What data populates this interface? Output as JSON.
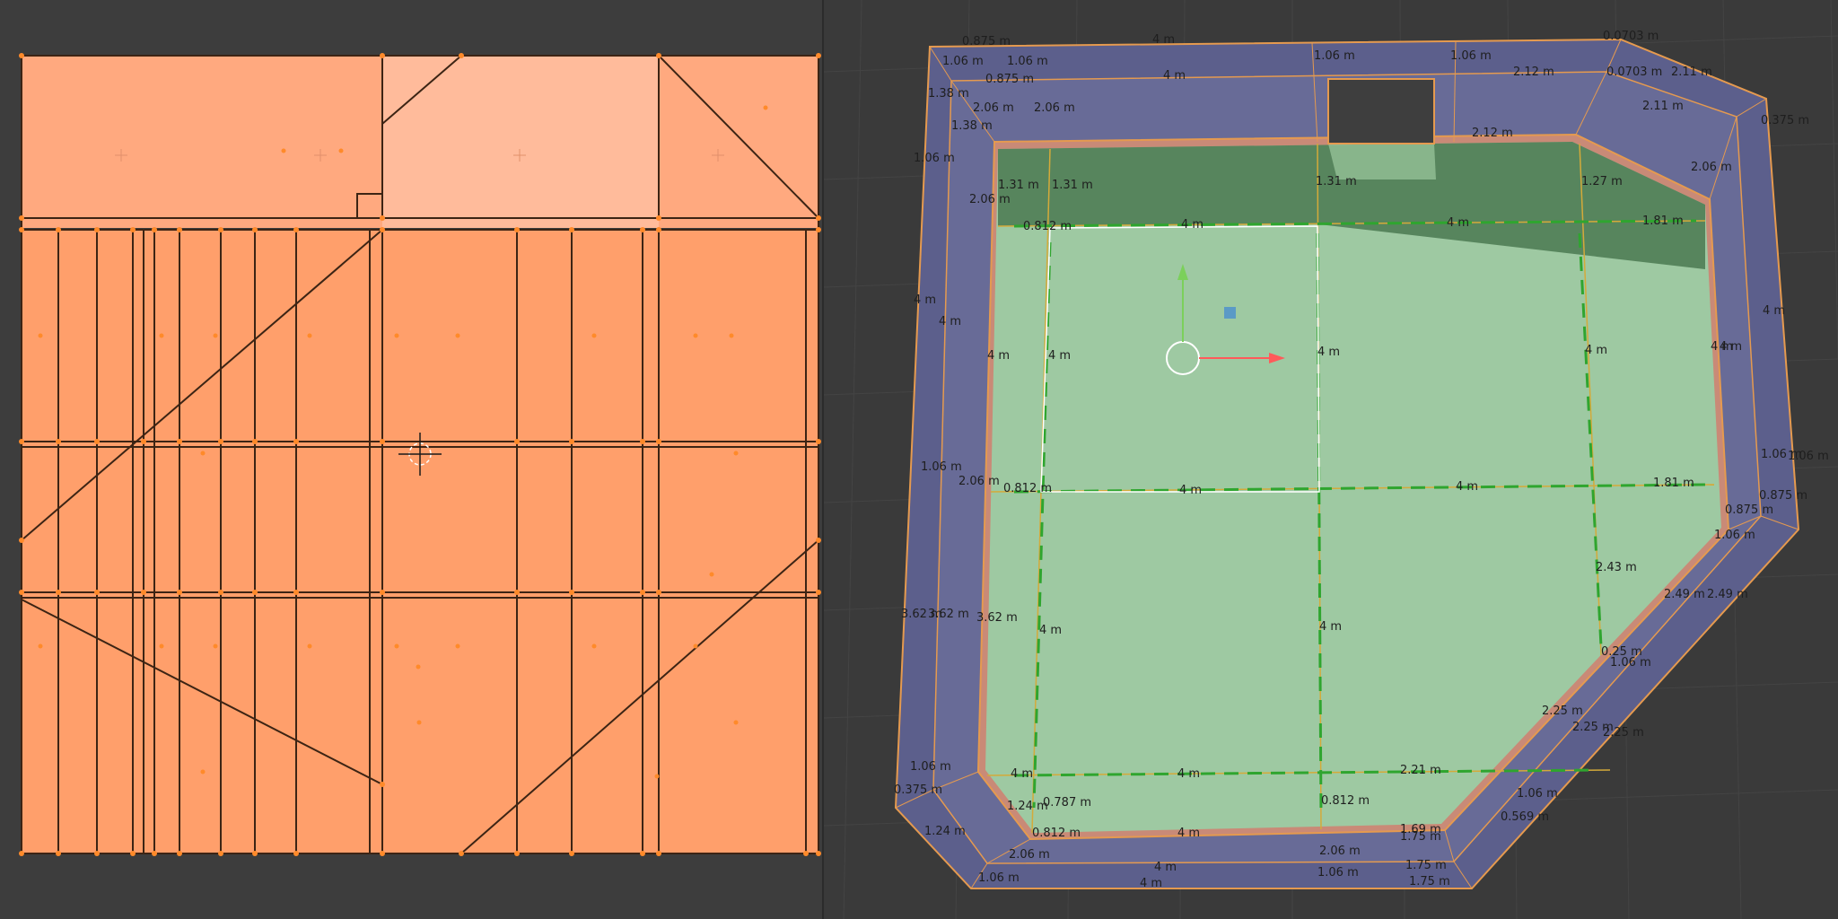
{
  "uv_editor": {
    "name": "UV Editor",
    "selection_color": "#ff9f6b",
    "highlight_color": "#ffbfa0",
    "edge_color": "#3c2414",
    "vertex_color": "#ff8a2a"
  },
  "viewport": {
    "name": "3D Viewport",
    "background": "#3a3a3a",
    "floor_color": "#9ec9a2",
    "wall_color": "#5c5f8c",
    "labels": {
      "top_left_a": "0.875 m",
      "top_left_b": "1.06 m",
      "top_left_c": "1.06 m",
      "top_left_d": "0.875 m",
      "top_left_e": "1.38 m",
      "top_left_f": "2.06 m",
      "top_left_g": "2.06 m",
      "top_left_h": "1.38 m",
      "top_mid_a": "4 m",
      "top_mid_b": "4 m",
      "top_mid_c": "1.06 m",
      "top_mid_d": "1.06 m",
      "top_right_a": "2.12 m",
      "top_right_b": "0.0703 m",
      "top_right_c": "0.0703 m",
      "top_right_d": "2.11 m",
      "top_right_e": "2.11 m",
      "top_right_f": "0.375 m",
      "top_right_g": "2.06 m",
      "top_right_h": "2.12 m",
      "inner_a": "1.31 m",
      "inner_b": "1.31 m",
      "inner_c": "1.31 m",
      "inner_d": "1.27 m",
      "inner_e": "0.812 m",
      "left_a": "1.06 m",
      "left_b": "2.06 m",
      "left_c": "4 m",
      "left_d": "4 m",
      "left_e": "4 m",
      "left_f": "1.06 m",
      "left_g": "2.06 m",
      "left_h": "3.62 m",
      "left_i": "3.62 m",
      "left_j": "3.62 m",
      "floor_a": "4 m",
      "floor_b": "4 m",
      "floor_c": "1.81 m",
      "floor_d": "4 m",
      "floor_e": "4 m",
      "floor_f": "4 m",
      "floor_g": "4 m",
      "floor_h": "4 m",
      "floor_i": "4 m",
      "floor_j": "4 m",
      "floor_k": "1.81 m",
      "floor_l": "2.43 m",
      "floor_m": "4 m",
      "floor_n": "4 m",
      "floor_o": "0.812 m",
      "floor_p": "0.812 m",
      "floor_q": "2.21 m",
      "floor_r": "4 m",
      "floor_s": "4 m",
      "floor_t": "0.812 m",
      "floor_u": "0.787 m",
      "right_a": "1.06 m",
      "right_b": "4 m",
      "right_c": "4 m",
      "right_d": "1.06 m",
      "right_e": "0.875 m",
      "right_f": "0.875 m",
      "right_g": "1.06 m",
      "right_h": "2.49 m",
      "right_i": "2.49 m",
      "right_j": "0.25 m",
      "right_k": "1.06 m",
      "right_l": "2.25 m",
      "right_m": "2.25 m",
      "right_n": "2.25 m",
      "bottom_a": "1.06 m",
      "bottom_b": "1.24 m",
      "bottom_c": "1.24 m",
      "bottom_d": "2.06 m",
      "bottom_e": "1.06 m",
      "bottom_f": "4 m",
      "bottom_g": "4 m",
      "bottom_h": "2.06 m",
      "bottom_i": "1.06 m",
      "bottom_j": "1.75 m",
      "bottom_k": "1.75 m",
      "bottom_l": "1.75 m",
      "bottom_m": "1.69 m",
      "bottom_n": "0.569 m",
      "bottom_o": "1.06 m",
      "bottom_p": "0.375 m"
    }
  }
}
